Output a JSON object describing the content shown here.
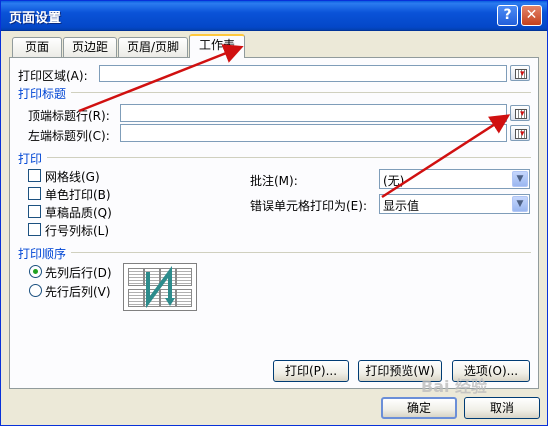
{
  "window": {
    "title": "页面设置"
  },
  "tabs": [
    {
      "label": "页面"
    },
    {
      "label": "页边距"
    },
    {
      "label": "页眉/页脚"
    },
    {
      "label": "工作表"
    }
  ],
  "print_area": {
    "label": "打印区域(A):",
    "value": ""
  },
  "print_titles": {
    "group_label": "打印标题",
    "top_rows_label": "顶端标题行(R):",
    "top_rows_value": "",
    "left_cols_label": "左端标题列(C):",
    "left_cols_value": ""
  },
  "print": {
    "group_label": "打印",
    "gridlines": "网格线(G)",
    "mono": "单色打印(B)",
    "draft": "草稿品质(Q)",
    "headings": "行号列标(L)",
    "comments_label": "批注(M):",
    "comments_value": "(无)",
    "errors_label": "错误单元格打印为(E):",
    "errors_value": "显示值"
  },
  "page_order": {
    "group_label": "打印顺序",
    "down_then_over": "先列后行(D)",
    "over_then_down": "先行后列(V)",
    "selected": "down_then_over"
  },
  "buttons": {
    "print": "打印(P)...",
    "preview": "打印预览(W)",
    "options": "选项(O)...",
    "ok": "确定",
    "cancel": "取消"
  },
  "watermark": "Bai 经验",
  "colors": {
    "titlebar": "#0a53d8",
    "group_title": "#0046d5",
    "annotation_arrow": "#d01010",
    "tab_highlight": "#ffc83c"
  }
}
